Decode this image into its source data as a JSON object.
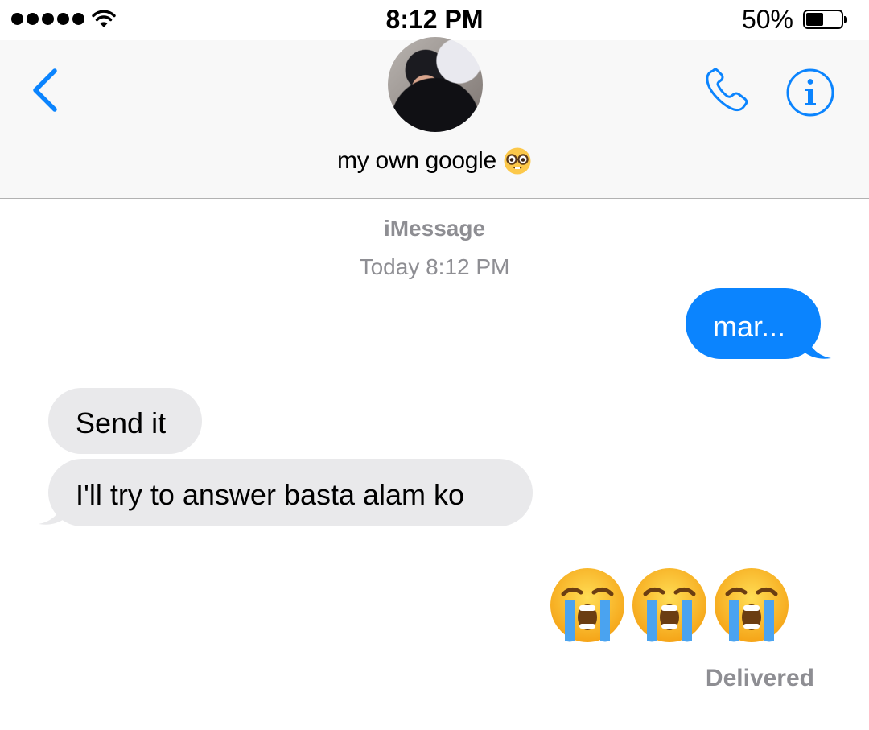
{
  "status_bar": {
    "time": "8:12 PM",
    "battery_percent": "50%",
    "battery_level": 0.5,
    "signal_bars": 5,
    "icons": [
      "signal-dots-icon",
      "wifi-icon",
      "battery-icon"
    ]
  },
  "header": {
    "contact_name": "my own google",
    "contact_emoji": "nerd-face-emoji",
    "icons": [
      "back-chevron-icon",
      "phone-icon",
      "info-icon"
    ]
  },
  "conversation": {
    "service": "iMessage",
    "timestamp": "Today 8:12 PM",
    "messages": [
      {
        "direction": "sent",
        "text": "mar..."
      },
      {
        "direction": "received",
        "text": "Send it"
      },
      {
        "direction": "received",
        "text": "I'll try to answer basta alam ko"
      },
      {
        "direction": "sent",
        "emoji": [
          "loudly-crying-face",
          "loudly-crying-face",
          "loudly-crying-face"
        ]
      }
    ],
    "status": "Delivered"
  },
  "colors": {
    "accent": "#0b84fe",
    "received_bubble": "#e9e9eb",
    "secondary_text": "#8e8e93",
    "header_bg": "#f8f8f8"
  }
}
